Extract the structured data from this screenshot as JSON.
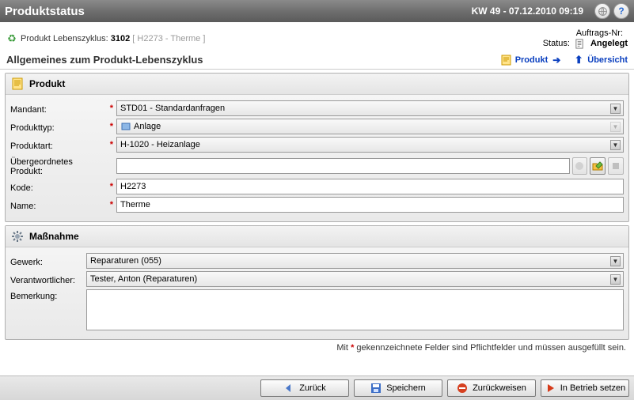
{
  "header": {
    "title": "Produktstatus",
    "datetime": "KW 49 - 07.12.2010 09:19"
  },
  "subheader": {
    "label": "Produkt Lebenszyklus:",
    "id": "3102",
    "ref": "[ H2273 - Therme ]",
    "order_label": "Auftrags-Nr:",
    "order_value": "",
    "status_label": "Status:",
    "status_value": "Angelegt"
  },
  "toolbar": {
    "heading": "Allgemeines zum Produkt-Lebenszyklus",
    "product_link": "Produkt",
    "overview_link": "Übersicht"
  },
  "panel_product": {
    "title": "Produkt",
    "mandant": {
      "label": "Mandant:",
      "value": "STD01 - Standardanfragen"
    },
    "produkttyp": {
      "label": "Produkttyp:",
      "value": "Anlage"
    },
    "produktart": {
      "label": "Produktart:",
      "value": "H-1020 - Heizanlage"
    },
    "parent": {
      "label": "Übergeordnetes Produkt:",
      "value": ""
    },
    "kode": {
      "label": "Kode:",
      "value": "H2273"
    },
    "name": {
      "label": "Name:",
      "value": "Therme"
    }
  },
  "panel_action": {
    "title": "Maßnahme",
    "gewerk": {
      "label": "Gewerk:",
      "value": "Reparaturen (055)"
    },
    "resp": {
      "label": "Verantwortlicher:",
      "value": "Tester, Anton (Reparaturen)"
    },
    "bemerkung": {
      "label": "Bemerkung:",
      "value": ""
    }
  },
  "footnote": {
    "prefix": "Mit ",
    "suffix": " gekennzeichnete Felder sind Pflichtfelder und müssen ausgefüllt sein."
  },
  "footer": {
    "back": "Zurück",
    "save": "Speichern",
    "reject": "Zurückweisen",
    "commission": "In Betrieb setzen"
  }
}
